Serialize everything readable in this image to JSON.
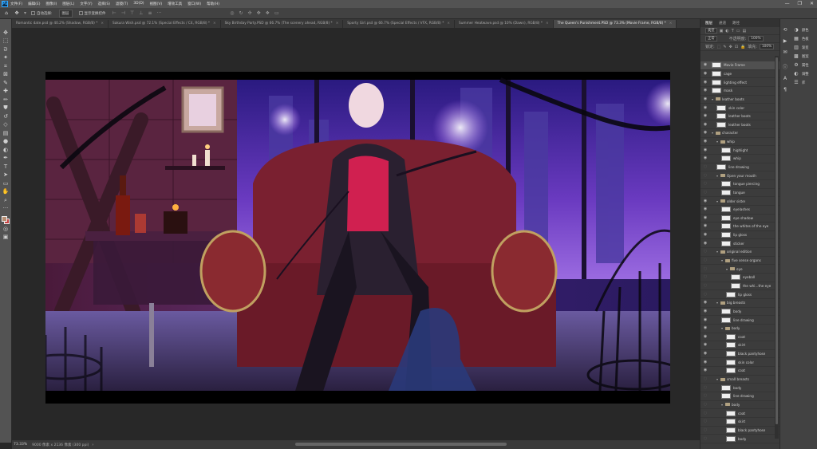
{
  "menu": {
    "logo": "Ps",
    "items": [
      "文件(F)",
      "编辑(E)",
      "图像(I)",
      "图层(L)",
      "文字(Y)",
      "选择(S)",
      "滤镜(T)",
      "3D(D)",
      "视图(V)",
      "增效工具",
      "窗口(W)",
      "帮助(H)"
    ],
    "win_minimize": "—",
    "win_restore": "❐",
    "win_close": "✕"
  },
  "options": {
    "auto_select_label": "自动选择:",
    "auto_select_value": "图层",
    "show_transform_label": "显示变换控件"
  },
  "tabs": [
    {
      "label": "Romantic date.psd @ 40.2% (Shadow, RGB/8) *",
      "active": false
    },
    {
      "label": "Sakura Wish.psd @ 72.1% (Special Effects / C4, RGB/8) *",
      "active": false
    },
    {
      "label": "Sky Birthday Party.PSD @ 66.7% (The scenery ahead, RGB/8) *",
      "active": false
    },
    {
      "label": "Sporty Girl.psd @ 66.7% (Special Effects / VFX, RGB/8) *",
      "active": false
    },
    {
      "label": "Summer Heatwave.psd @ 10% (Dawn), RGB/8) *",
      "active": false
    },
    {
      "label": "The Queen's Punishment.PSD @ 73.3% (Movie Frame, RGB/8) *",
      "active": true
    }
  ],
  "tab_close": "×",
  "status": {
    "zoom": "73.33%",
    "doc": "9000 像素 x 2136 像素 (300 ppi)",
    "arrow": "›"
  },
  "panel": {
    "tabs": [
      "图层",
      "通道",
      "路径"
    ],
    "filter_kind": "类型",
    "blend_mode": "正常",
    "opacity_label": "不透明度:",
    "opacity_value": "100%",
    "lock_label": "锁定:",
    "fill_label": "填充:",
    "fill_value": "100%"
  },
  "layers": [
    {
      "name": "Movie Frame",
      "type": "layer",
      "depth": 0,
      "visible": true,
      "selected": true
    },
    {
      "name": "cage",
      "type": "layer",
      "depth": 0,
      "visible": true
    },
    {
      "name": "lighting effect",
      "type": "layer",
      "depth": 0,
      "visible": true
    },
    {
      "name": "mask",
      "type": "layer",
      "depth": 0,
      "visible": true
    },
    {
      "name": "leather boots",
      "type": "group",
      "depth": 0,
      "visible": true
    },
    {
      "name": "skin color",
      "type": "layer",
      "depth": 1,
      "visible": true
    },
    {
      "name": "leather boots",
      "type": "layer",
      "depth": 1,
      "visible": true
    },
    {
      "name": "leather boots",
      "type": "layer",
      "depth": 1,
      "visible": true
    },
    {
      "name": "character",
      "type": "group",
      "depth": 0,
      "visible": true
    },
    {
      "name": "whip",
      "type": "group",
      "depth": 1,
      "visible": true
    },
    {
      "name": "highlight",
      "type": "layer",
      "depth": 2,
      "visible": true
    },
    {
      "name": "whip",
      "type": "layer",
      "depth": 2,
      "visible": true
    },
    {
      "name": "line drawing",
      "type": "layer",
      "depth": 1,
      "visible": false
    },
    {
      "name": "Open your mouth",
      "type": "group",
      "depth": 1,
      "visible": false
    },
    {
      "name": "tongue piercing",
      "type": "layer",
      "depth": 2,
      "visible": false
    },
    {
      "name": "tongue",
      "type": "layer",
      "depth": 2,
      "visible": false
    },
    {
      "name": "older sister",
      "type": "group",
      "depth": 1,
      "visible": true
    },
    {
      "name": "eyelashes",
      "type": "layer",
      "depth": 2,
      "visible": true
    },
    {
      "name": "eye shadow",
      "type": "layer",
      "depth": 2,
      "visible": true
    },
    {
      "name": "the whites of the eye",
      "type": "layer",
      "depth": 2,
      "visible": true
    },
    {
      "name": "lip gloss",
      "type": "layer",
      "depth": 2,
      "visible": true
    },
    {
      "name": "sticker",
      "type": "layer",
      "depth": 2,
      "visible": true
    },
    {
      "name": "original edition",
      "type": "group",
      "depth": 1,
      "visible": false
    },
    {
      "name": "five sense organs",
      "type": "group",
      "depth": 2,
      "visible": false
    },
    {
      "name": "eye",
      "type": "group",
      "depth": 3,
      "visible": false
    },
    {
      "name": "eyeball",
      "type": "layer",
      "depth": 4,
      "visible": false
    },
    {
      "name": "the whi...the eye",
      "type": "layer",
      "depth": 4,
      "visible": false
    },
    {
      "name": "lip gloss",
      "type": "layer",
      "depth": 3,
      "visible": false
    },
    {
      "name": "big breasts",
      "type": "group",
      "depth": 1,
      "visible": true
    },
    {
      "name": "body",
      "type": "layer",
      "depth": 2,
      "visible": true
    },
    {
      "name": "line drawing",
      "type": "layer",
      "depth": 2,
      "visible": true
    },
    {
      "name": "body",
      "type": "group",
      "depth": 2,
      "visible": true
    },
    {
      "name": "coat",
      "type": "layer",
      "depth": 3,
      "visible": true
    },
    {
      "name": "skirt",
      "type": "layer",
      "depth": 3,
      "visible": true
    },
    {
      "name": "black pantyhose",
      "type": "layer",
      "depth": 3,
      "visible": true
    },
    {
      "name": "skin color",
      "type": "layer",
      "depth": 3,
      "visible": true
    },
    {
      "name": "coat",
      "type": "layer",
      "depth": 3,
      "visible": true
    },
    {
      "name": "small breasts",
      "type": "group",
      "depth": 1,
      "visible": false
    },
    {
      "name": "body",
      "type": "layer",
      "depth": 2,
      "visible": false
    },
    {
      "name": "line drawing",
      "type": "layer",
      "depth": 2,
      "visible": false
    },
    {
      "name": "body",
      "type": "group",
      "depth": 2,
      "visible": false
    },
    {
      "name": "coat",
      "type": "layer",
      "depth": 3,
      "visible": false
    },
    {
      "name": "skirt",
      "type": "layer",
      "depth": 3,
      "visible": false
    },
    {
      "name": "black pantyhose",
      "type": "layer",
      "depth": 3,
      "visible": false
    },
    {
      "name": "body",
      "type": "layer",
      "depth": 3,
      "visible": false
    }
  ],
  "side_icons": [
    {
      "icon": "history-icon",
      "label": ""
    },
    {
      "icon": "play-icon",
      "label": ""
    },
    {
      "icon": "comment-icon",
      "label": ""
    },
    {
      "icon": "info-icon",
      "label": ""
    },
    {
      "icon": "character-icon",
      "label": ""
    },
    {
      "icon": "paragraph-icon",
      "label": ""
    }
  ],
  "side_panels": [
    {
      "icon": "color-icon",
      "label": "颜色"
    },
    {
      "icon": "swatches-icon",
      "label": "色板"
    },
    {
      "icon": "gradient-icon",
      "label": "渐变"
    },
    {
      "icon": "pattern-icon",
      "label": "图案"
    },
    {
      "icon": "properties-icon",
      "label": "属性"
    },
    {
      "icon": "adjustments-icon",
      "label": "调整"
    },
    {
      "icon": "library-icon",
      "label": "库"
    }
  ],
  "colors": {
    "foreground": "#b58c70",
    "background": "#c84040",
    "ps_blue": "#31a8ff"
  }
}
